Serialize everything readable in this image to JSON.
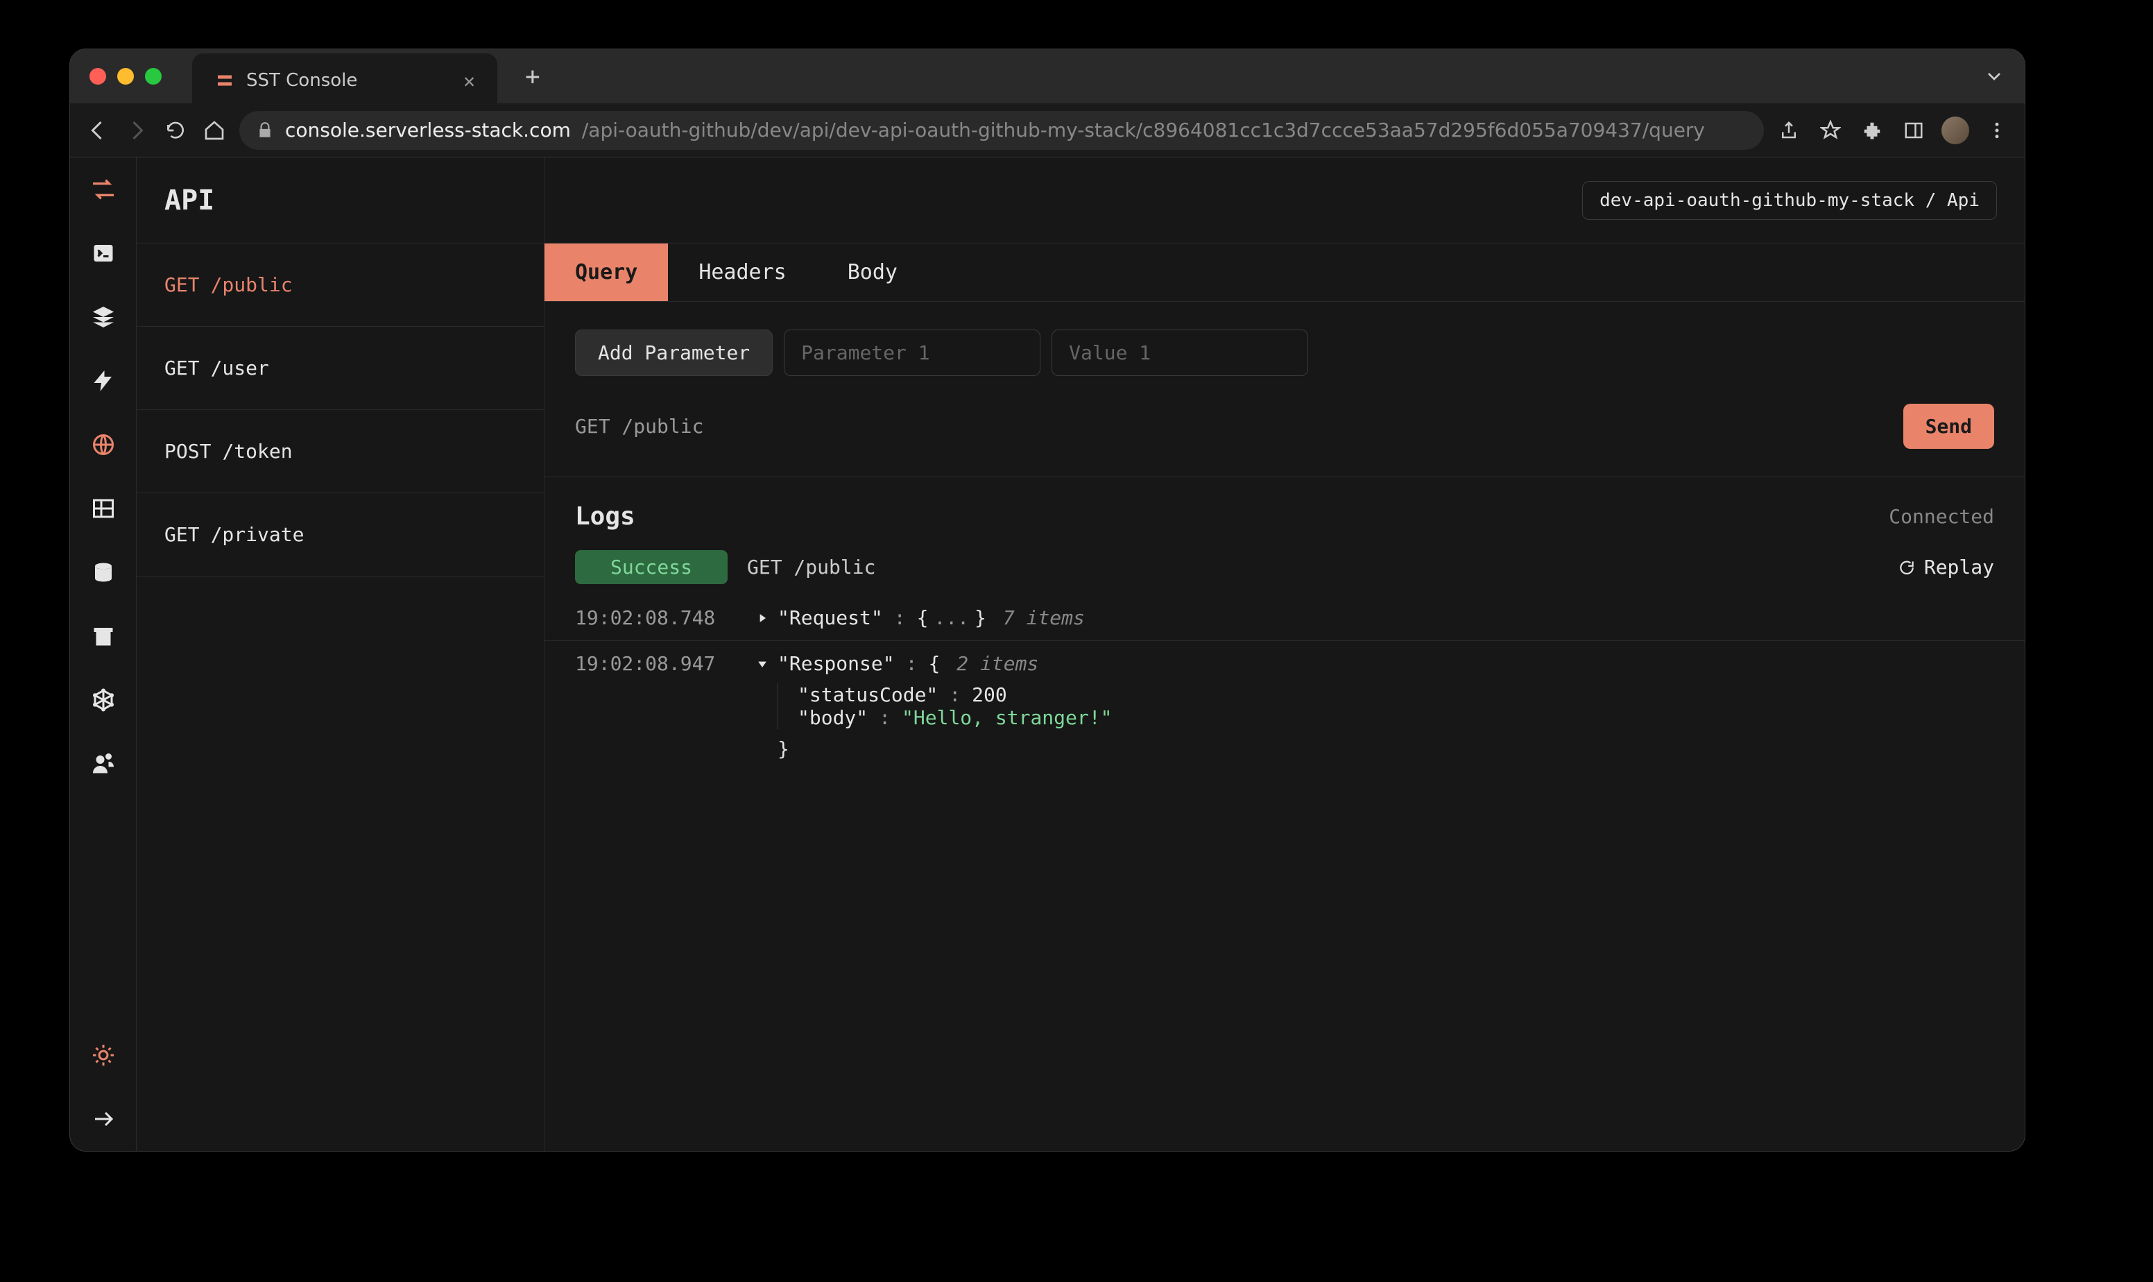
{
  "browser": {
    "tab_title": "SST Console",
    "url_domain": "console.serverless-stack.com",
    "url_path": "/api-oauth-github/dev/api/dev-api-oauth-github-my-stack/c8964081cc1c3d7ccce53aa57d295f6d055a709437/query"
  },
  "header": {
    "title": "API",
    "breadcrumb": "dev-api-oauth-github-my-stack / Api"
  },
  "routes": [
    {
      "method": "GET",
      "path": "/public",
      "active": true
    },
    {
      "method": "GET",
      "path": "/user",
      "active": false
    },
    {
      "method": "POST",
      "path": "/token",
      "active": false
    },
    {
      "method": "GET",
      "path": "/private",
      "active": false
    }
  ],
  "tabs": [
    {
      "label": "Query",
      "active": true
    },
    {
      "label": "Headers",
      "active": false
    },
    {
      "label": "Body",
      "active": false
    }
  ],
  "params": {
    "add_button": "Add Parameter",
    "name_placeholder": "Parameter 1",
    "value_placeholder": "Value 1"
  },
  "request": {
    "description": "GET /public",
    "send_button": "Send"
  },
  "logs": {
    "title": "Logs",
    "status_text": "Connected",
    "badge": "Success",
    "route": "GET /public",
    "replay": "Replay",
    "entries": [
      {
        "time": "19:02:08.748",
        "label": "\"Request\"",
        "collapsed": true,
        "items_count": "7 items"
      },
      {
        "time": "19:02:08.947",
        "label": "\"Response\"",
        "collapsed": false,
        "items_count": "2 items",
        "body": {
          "statusCode": 200,
          "body": "\"Hello, stranger!\""
        }
      }
    ]
  }
}
